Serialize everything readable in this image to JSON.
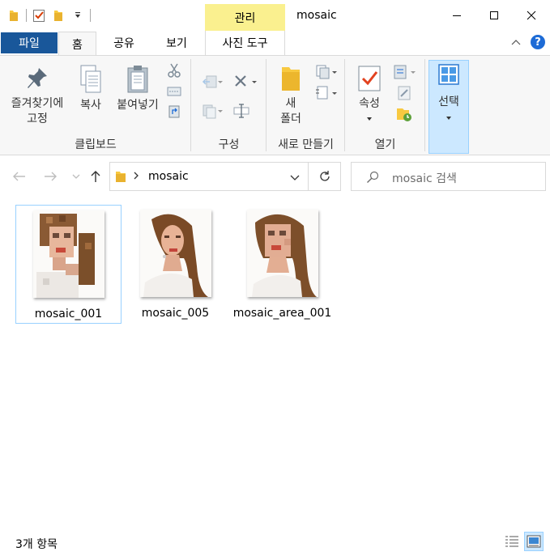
{
  "window": {
    "title": "mosaic",
    "context_tab_label": "관리"
  },
  "ribbon_tabs": {
    "file": "파일",
    "home": "홈",
    "share": "공유",
    "view": "보기",
    "picture_tools": "사진 도구"
  },
  "clipboard": {
    "pin_label_1": "즐겨찾기에",
    "pin_label_2": "고정",
    "copy": "복사",
    "paste": "붙여넣기",
    "group": "클립보드"
  },
  "organize": {
    "group": "구성"
  },
  "new": {
    "folder_label_1": "새",
    "folder_label_2": "폴더",
    "group": "새로 만들기"
  },
  "open": {
    "properties": "속성",
    "group": "열기"
  },
  "select": {
    "label": "선택"
  },
  "address": {
    "path_segment": "mosaic"
  },
  "search": {
    "placeholder": "mosaic 검색"
  },
  "files": [
    {
      "name": "mosaic_001",
      "selected": true,
      "style": "mosaic-full"
    },
    {
      "name": "mosaic_005",
      "selected": false,
      "style": "mosaic-light"
    },
    {
      "name": "mosaic_area_001",
      "selected": false,
      "style": "mosaic-face"
    }
  ],
  "status": {
    "item_count": "3개 항목"
  },
  "colors": {
    "file_tab": "#19579a",
    "context_tab": "#faf08f",
    "selection": "#cce8ff",
    "selection_border": "#99d1ff",
    "help": "#1d6bd6"
  }
}
